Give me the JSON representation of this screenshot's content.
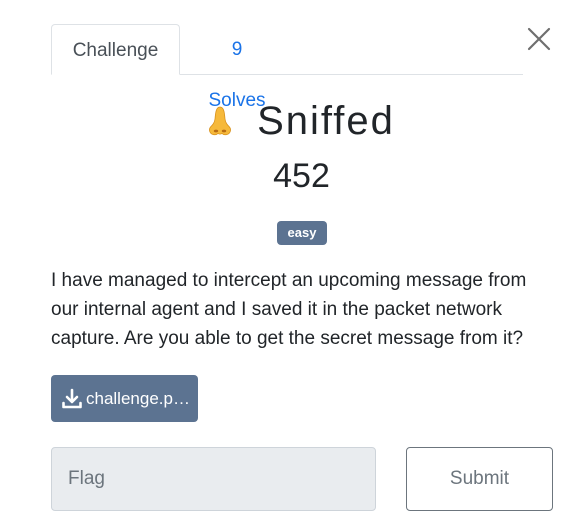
{
  "tabs": [
    {
      "label": "Challenge",
      "active": true
    },
    {
      "label": "9 Solves",
      "active": false
    }
  ],
  "challenge": {
    "icon": "nose-icon",
    "name": "Sniffed",
    "value": "452",
    "tag": "easy",
    "description": "I have managed to intercept an upcoming message from our internal agent and I saved it in the packet network capture. Are you able to get the secret message from it?",
    "file_label": "challenge.p…"
  },
  "form": {
    "flag_placeholder": "Flag",
    "flag_value": "",
    "submit_label": "Submit"
  },
  "colors": {
    "accent": "#1a73e8",
    "tag_bg": "#5c7391",
    "input_bg": "#e9ecef"
  }
}
